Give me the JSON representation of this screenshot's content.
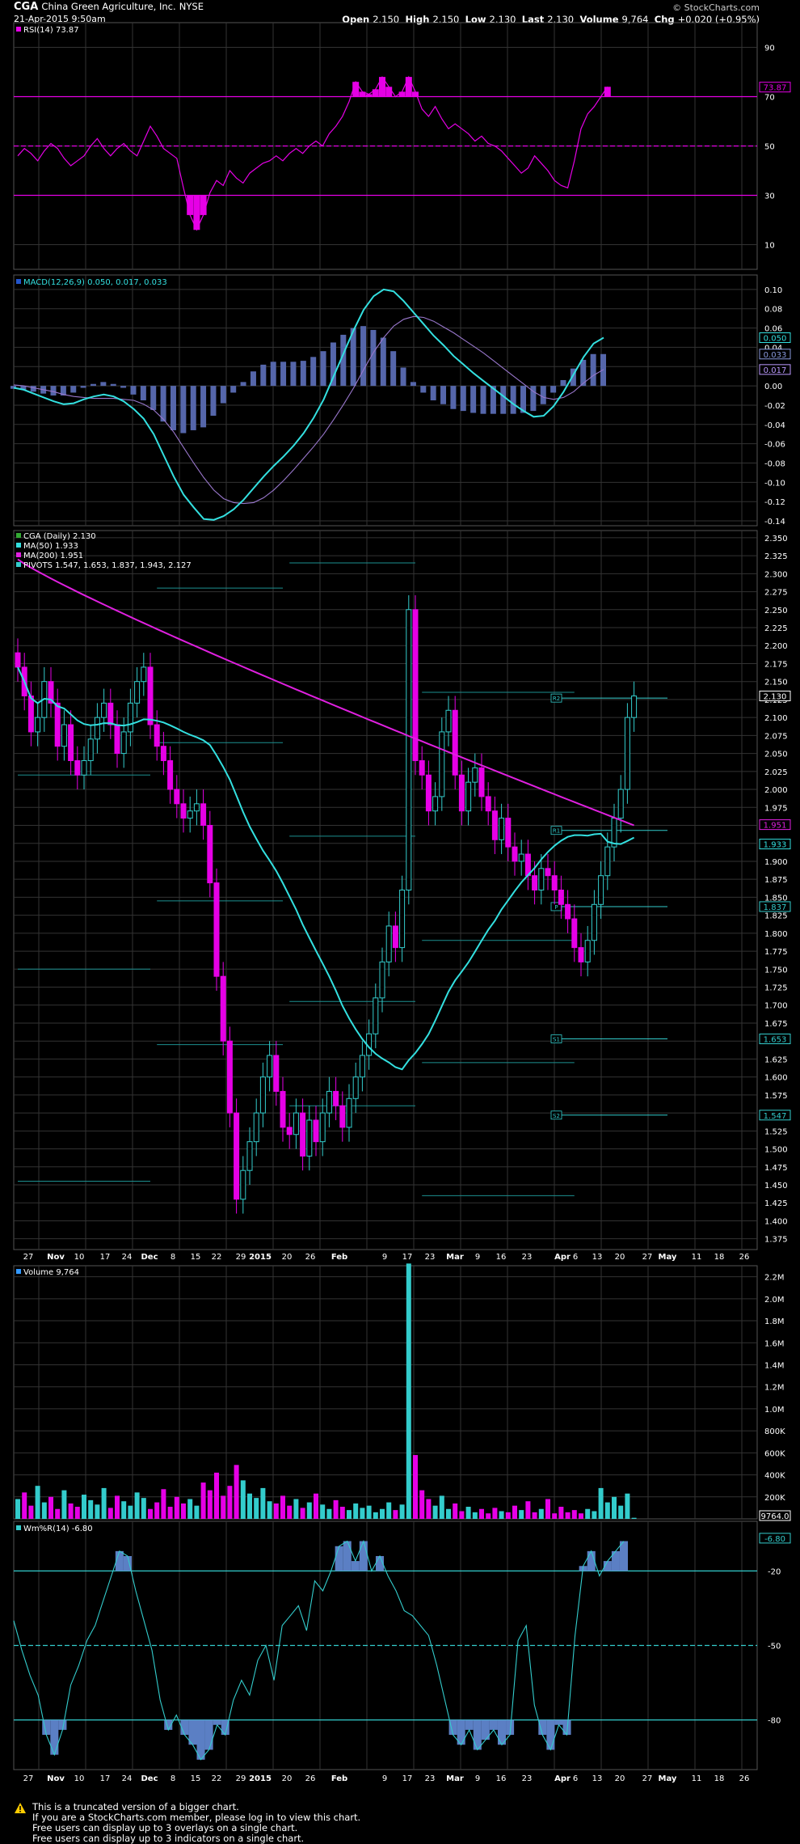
{
  "header": {
    "symbol": "CGA",
    "company": "China Green Agriculture, Inc.",
    "exchange": "NYSE",
    "datetime": "21-Apr-2015 9:50am",
    "watermark": "© StockCharts.com",
    "quote": [
      {
        "label": "Open",
        "value": "2.150"
      },
      {
        "label": "High",
        "value": "2.150"
      },
      {
        "label": "Low",
        "value": "2.130"
      },
      {
        "label": "Last",
        "value": "2.130"
      },
      {
        "label": "Volume",
        "value": "9,764"
      },
      {
        "label": "Chg",
        "value": "+0.020 (+0.95%)"
      }
    ]
  },
  "panels": {
    "rsi": {
      "legend": "RSI(14) 73.87",
      "badge": "73.87"
    },
    "macd": {
      "legend": "MACD(12,26,9) 0.050, 0.017, 0.033",
      "badges": [
        "0.050",
        "0.033",
        "0.017"
      ]
    },
    "price": {
      "legend": [
        "CGA (Daily) 2.130",
        "MA(50) 1.933",
        "MA(200) 1.951",
        "PIVOTS 1.547, 1.653, 1.837, 1.943, 2.127"
      ],
      "badges": [
        "2.130",
        "1.951",
        "1.933",
        "1.837",
        "1.653",
        "1.547"
      ],
      "pivot_tags": [
        "R2",
        "R1",
        "P",
        "S1",
        "S2"
      ]
    },
    "volume": {
      "legend": "Volume 9,764",
      "badge": "9764.0"
    },
    "willr": {
      "legend": "Wm%R(14) -6.80",
      "badge": "-6.80"
    }
  },
  "x_axis": {
    "labels": [
      "27",
      "Nov",
      "10",
      "17",
      "24",
      "Dec",
      "8",
      "15",
      "22",
      "29",
      "2015",
      "20",
      "26",
      "Feb",
      "9",
      "17",
      "23",
      "Mar",
      "9",
      "16",
      "23",
      "Apr",
      "6",
      "13",
      "20",
      "27",
      "May",
      "11",
      "18",
      "26"
    ]
  },
  "footer": {
    "lines": [
      "This is a truncated version of a bigger chart.",
      "If you are a StockCharts.com member, please log in to view this chart.",
      "Free users can display up to 3 overlays on a single chart.",
      "Free users can display up to 3 indicators on a single chart."
    ]
  },
  "colors": {
    "up": "#33cccc",
    "down": "#e600e6",
    "ma50": "#33e0e0",
    "ma200": "#e020e0",
    "macd_hist": "#5566aa",
    "grid": "#333333",
    "text": "#ffffff"
  },
  "chart_data": [
    {
      "type": "line",
      "title": "RSI(14) 73.87",
      "ylim": [
        0,
        100
      ],
      "yticks": [
        90,
        70,
        50,
        30,
        10
      ],
      "reference_lines": [
        70,
        50,
        30
      ],
      "values": [
        46,
        49,
        47,
        44,
        48,
        51,
        49,
        45,
        42,
        44,
        46,
        50,
        53,
        49,
        46,
        49,
        51,
        48,
        46,
        52,
        58,
        54,
        49,
        47,
        45,
        33,
        22,
        16,
        22,
        31,
        36,
        34,
        40,
        37,
        35,
        39,
        41,
        43,
        44,
        46,
        44,
        47,
        49,
        47,
        50,
        52,
        50,
        55,
        58,
        62,
        68,
        76,
        72,
        71,
        73,
        78,
        74,
        70,
        72,
        78,
        72,
        65,
        62,
        66,
        61,
        57,
        59,
        57,
        55,
        52,
        54,
        51,
        50,
        48,
        45,
        42,
        39,
        41,
        46,
        43,
        40,
        36,
        34,
        33,
        44,
        57,
        63,
        66,
        70,
        74
      ]
    },
    {
      "type": "line",
      "title": "MACD(12,26,9) 0.050, 0.017, 0.033",
      "ylim": [
        -0.145,
        0.115
      ],
      "yticks": [
        0.1,
        0.08,
        0.06,
        0.04,
        0.02,
        0.0,
        -0.02,
        -0.04,
        -0.06,
        -0.08,
        -0.1,
        -0.12,
        -0.14
      ],
      "series": [
        {
          "name": "MACD",
          "values": [
            -0.002,
            -0.004,
            -0.008,
            -0.012,
            -0.016,
            -0.019,
            -0.018,
            -0.014,
            -0.011,
            -0.009,
            -0.011,
            -0.016,
            -0.024,
            -0.034,
            -0.05,
            -0.072,
            -0.094,
            -0.113,
            -0.126,
            -0.138,
            -0.139,
            -0.135,
            -0.128,
            -0.118,
            -0.106,
            -0.094,
            -0.083,
            -0.073,
            -0.062,
            -0.049,
            -0.033,
            -0.014,
            0.01,
            0.034,
            0.058,
            0.079,
            0.093,
            0.1,
            0.098,
            0.088,
            0.076,
            0.064,
            0.052,
            0.042,
            0.031,
            0.022,
            0.013,
            0.005,
            -0.003,
            -0.011,
            -0.019,
            -0.026,
            -0.032,
            -0.031,
            -0.021,
            -0.006,
            0.012,
            0.03,
            0.044,
            0.05
          ]
        },
        {
          "name": "Signal",
          "values": [
            0.001,
            0.0,
            -0.002,
            -0.004,
            -0.006,
            -0.009,
            -0.011,
            -0.012,
            -0.013,
            -0.013,
            -0.013,
            -0.014,
            -0.015,
            -0.019,
            -0.025,
            -0.035,
            -0.048,
            -0.064,
            -0.08,
            -0.095,
            -0.108,
            -0.117,
            -0.121,
            -0.122,
            -0.121,
            -0.116,
            -0.108,
            -0.098,
            -0.087,
            -0.075,
            -0.063,
            -0.05,
            -0.035,
            -0.019,
            -0.002,
            0.017,
            0.035,
            0.05,
            0.062,
            0.069,
            0.072,
            0.071,
            0.067,
            0.061,
            0.055,
            0.048,
            0.041,
            0.034,
            0.026,
            0.018,
            0.01,
            0.002,
            -0.006,
            -0.012,
            -0.014,
            -0.012,
            -0.006,
            0.003,
            0.011,
            0.017
          ]
        },
        {
          "name": "Histogram",
          "values": [
            -0.003,
            -0.004,
            -0.006,
            -0.008,
            -0.01,
            -0.01,
            -0.007,
            -0.002,
            0.002,
            0.004,
            0.002,
            -0.002,
            -0.009,
            -0.015,
            -0.025,
            -0.037,
            -0.046,
            -0.049,
            -0.046,
            -0.043,
            -0.031,
            -0.018,
            -0.007,
            0.004,
            0.015,
            0.022,
            0.025,
            0.025,
            0.025,
            0.026,
            0.03,
            0.036,
            0.045,
            0.053,
            0.06,
            0.062,
            0.058,
            0.05,
            0.036,
            0.019,
            0.004,
            -0.007,
            -0.015,
            -0.019,
            -0.024,
            -0.026,
            -0.028,
            -0.029,
            -0.029,
            -0.029,
            -0.029,
            -0.028,
            -0.026,
            -0.019,
            -0.007,
            0.006,
            0.018,
            0.027,
            0.033,
            0.033
          ]
        }
      ]
    },
    {
      "type": "candlestick",
      "title": "CGA (Daily) 2.130",
      "ylim": [
        1.36,
        2.36
      ],
      "yticks": [
        2.35,
        2.325,
        2.3,
        2.275,
        2.25,
        2.225,
        2.2,
        2.175,
        2.15,
        2.125,
        2.1,
        2.075,
        2.05,
        2.025,
        2.0,
        1.975,
        1.95,
        1.925,
        1.9,
        1.875,
        1.85,
        1.825,
        1.8,
        1.775,
        1.75,
        1.725,
        1.7,
        1.675,
        1.65,
        1.625,
        1.6,
        1.575,
        1.55,
        1.525,
        1.5,
        1.475,
        1.45,
        1.425,
        1.4,
        1.375
      ],
      "close": [
        2.17,
        2.13,
        2.08,
        2.1,
        2.15,
        2.12,
        2.06,
        2.09,
        2.04,
        2.02,
        2.04,
        2.07,
        2.1,
        2.12,
        2.09,
        2.05,
        2.08,
        2.12,
        2.15,
        2.17,
        2.09,
        2.06,
        2.04,
        2.0,
        1.98,
        1.96,
        1.97,
        1.98,
        1.95,
        1.87,
        1.74,
        1.65,
        1.55,
        1.43,
        1.47,
        1.51,
        1.55,
        1.6,
        1.63,
        1.58,
        1.53,
        1.52,
        1.55,
        1.49,
        1.54,
        1.51,
        1.55,
        1.58,
        1.56,
        1.53,
        1.57,
        1.6,
        1.63,
        1.66,
        1.71,
        1.76,
        1.81,
        1.78,
        1.86,
        2.25,
        2.04,
        2.02,
        1.97,
        1.99,
        2.08,
        2.11,
        2.02,
        1.97,
        2.01,
        2.03,
        1.99,
        1.97,
        1.93,
        1.96,
        1.92,
        1.9,
        1.91,
        1.88,
        1.86,
        1.89,
        1.88,
        1.86,
        1.84,
        1.82,
        1.78,
        1.76,
        1.79,
        1.84,
        1.88,
        1.92,
        1.96,
        2.0,
        2.1,
        2.13
      ]
    },
    {
      "type": "bar",
      "title": "Volume 9,764",
      "ylim": [
        0,
        2300000
      ],
      "yticks_labels": [
        "2.2M",
        "2.0M",
        "1.8M",
        "1.6M",
        "1.4M",
        "1.2M",
        "1.0M",
        "800K",
        "600K",
        "400K",
        "200K"
      ],
      "values": [
        180000,
        240000,
        120000,
        300000,
        150000,
        200000,
        90000,
        260000,
        140000,
        110000,
        220000,
        170000,
        130000,
        280000,
        100000,
        210000,
        160000,
        120000,
        240000,
        190000,
        90000,
        150000,
        270000,
        110000,
        200000,
        140000,
        180000,
        120000,
        330000,
        260000,
        420000,
        210000,
        300000,
        490000,
        350000,
        230000,
        190000,
        280000,
        160000,
        140000,
        210000,
        120000,
        180000,
        100000,
        150000,
        230000,
        130000,
        90000,
        170000,
        110000,
        80000,
        140000,
        100000,
        120000,
        60000,
        90000,
        150000,
        80000,
        130000,
        2320000,
        580000,
        260000,
        180000,
        120000,
        210000,
        90000,
        140000,
        70000,
        110000,
        60000,
        90000,
        50000,
        100000,
        70000,
        60000,
        120000,
        80000,
        160000,
        60000,
        90000,
        180000,
        50000,
        110000,
        60000,
        80000,
        50000,
        90000,
        70000,
        280000,
        150000,
        200000,
        120000,
        230000,
        9764
      ]
    },
    {
      "type": "line",
      "title": "Wm%R(14) -6.80",
      "ylim": [
        -100,
        0
      ],
      "yticks": [
        -20,
        -50,
        -80
      ],
      "reference_lines": [
        -20,
        -50,
        -80
      ],
      "values": [
        -40,
        -52,
        -62,
        -70,
        -86,
        -94,
        -84,
        -66,
        -58,
        -48,
        -42,
        -32,
        -22,
        -12,
        -14,
        -28,
        -40,
        -52,
        -72,
        -84,
        -78,
        -86,
        -90,
        -96,
        -92,
        -82,
        -86,
        -72,
        -64,
        -70,
        -56,
        -50,
        -64,
        -42,
        -38,
        -34,
        -44,
        -24,
        -28,
        -20,
        -10,
        -8,
        -16,
        -8,
        -20,
        -14,
        -22,
        -28,
        -36,
        -38,
        -42,
        -46,
        -58,
        -72,
        -86,
        -90,
        -84,
        -92,
        -88,
        -84,
        -90,
        -86,
        -48,
        -42,
        -74,
        -86,
        -92,
        -82,
        -86,
        -46,
        -18,
        -12,
        -22,
        -16,
        -12,
        -8
      ]
    }
  ]
}
